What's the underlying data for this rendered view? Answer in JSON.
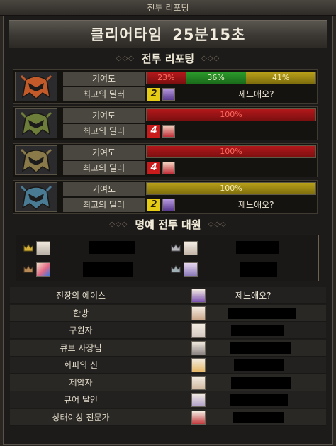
{
  "window": {
    "title": "전투 리포팅"
  },
  "clear_time": {
    "label": "클리어타임",
    "value": "25분15초"
  },
  "report_header": "전투 리포팅",
  "contribution_label": "기여도",
  "dealer_label": "최고의 딜러",
  "party": [
    {
      "icon": "red-helmet-icon",
      "color": "#c25a2a",
      "bars": [
        {
          "color": "red",
          "value": 23,
          "label": "23%"
        },
        {
          "color": "green",
          "value": 36,
          "label": "36%"
        },
        {
          "color": "yellow",
          "value": 41,
          "label": "41%"
        }
      ],
      "dealer_rank": "2",
      "dealer_rank_color": "yellow",
      "dealer_name": "제노애오?"
    },
    {
      "icon": "green-helmet-icon",
      "color": "#6d7d3a",
      "bars": [
        {
          "color": "red",
          "value": 100,
          "label": "100%"
        }
      ],
      "dealer_rank": "4",
      "dealer_rank_color": "red",
      "dealer_name": ""
    },
    {
      "icon": "gold-helmet-icon",
      "color": "#8a7a4a",
      "bars": [
        {
          "color": "red",
          "value": 100,
          "label": "100%"
        }
      ],
      "dealer_rank": "4",
      "dealer_rank_color": "red",
      "dealer_name": ""
    },
    {
      "icon": "blue-helmet-icon",
      "color": "#4a7b95",
      "bars": [
        {
          "color": "yellow",
          "value": 100,
          "label": "100%"
        }
      ],
      "dealer_rank": "2",
      "dealer_rank_color": "yellow",
      "dealer_name": "제노애오?"
    }
  ],
  "honor_header": "명예 전투 대원",
  "honor_members": [
    {
      "crown": "gold-crown-icon"
    },
    {
      "crown": "silver-crown-icon"
    },
    {
      "crown": "bronze-crown-icon"
    },
    {
      "crown": "silver-crown-icon"
    }
  ],
  "awards": [
    {
      "title": "전장의 에이스",
      "name": "제노애오?",
      "portrait_color": "#7a4fb0"
    },
    {
      "title": "한방",
      "name": "",
      "portrait_color": "#caa68a"
    },
    {
      "title": "구원자",
      "name": "",
      "portrait_color": "#d4c9c2"
    },
    {
      "title": "큐브 사장님",
      "name": "",
      "portrait_color": "#8a8382"
    },
    {
      "title": "회피의 신",
      "name": "",
      "portrait_color": "#e7b868"
    },
    {
      "title": "제압자",
      "name": "",
      "portrait_color": "#d0b8a0"
    },
    {
      "title": "큐어 달인",
      "name": "",
      "portrait_color": "#b0a0c8"
    },
    {
      "title": "상태이상 전문가",
      "name": "",
      "portrait_color": "#c2383c"
    }
  ]
}
